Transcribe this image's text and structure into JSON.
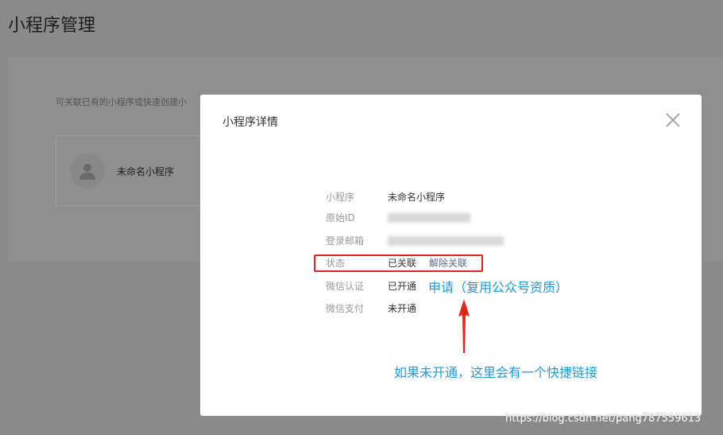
{
  "page": {
    "title": "小程序管理",
    "hint": "可关联已有的小程序或快速创建小",
    "card_name": "未命名小程序"
  },
  "modal": {
    "title": "小程序详情",
    "rows": [
      {
        "key": "小程序",
        "value": "未命名小程序"
      },
      {
        "key": "原始ID",
        "value": ""
      },
      {
        "key": "登录邮箱",
        "value": ""
      },
      {
        "key": "状态",
        "value": "已关联",
        "link": "解除关联"
      },
      {
        "key": "微信认证",
        "value": "已开通"
      },
      {
        "key": "微信支付",
        "value": "未开通"
      }
    ]
  },
  "annotations": {
    "apply": "申请（复用公众号资质）",
    "note": "如果未开通，这里会有一个快捷链接",
    "highlight_color": "#e5231b",
    "text_color": "#1a9be0"
  },
  "watermark": "https://blog.csdn.net/pang787559613"
}
